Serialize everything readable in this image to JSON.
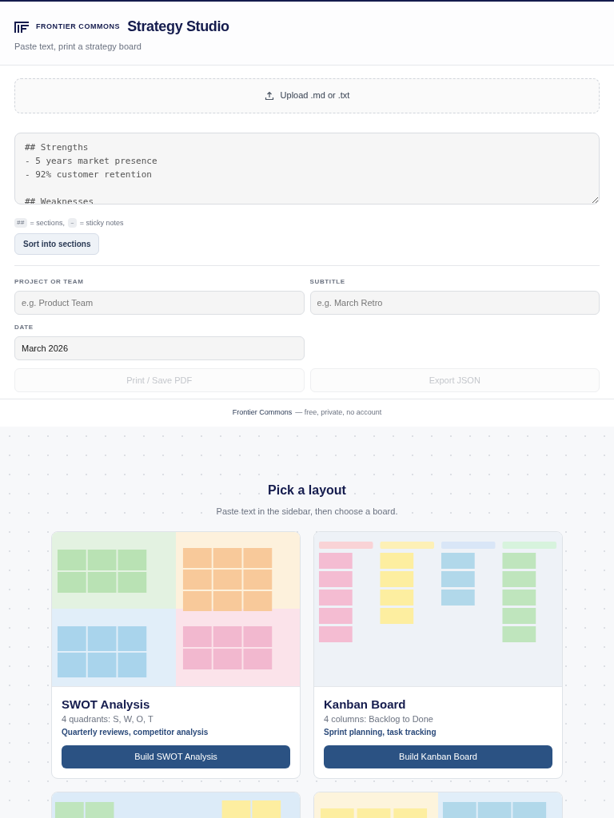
{
  "header": {
    "brand": "FRONTIER COMMONS",
    "title": "Strategy Studio",
    "tagline": "Paste text, print a strategy board"
  },
  "upload": {
    "label": "Upload .md or .txt"
  },
  "editor": {
    "value": "## Strengths\n- 5 years market presence\n- 92% customer retention\n\n## Weaknesses"
  },
  "hint": [
    {
      "kind": "code",
      "text": "##"
    },
    {
      "kind": "text",
      "text": "= sections,"
    },
    {
      "kind": "code",
      "text": "–"
    },
    {
      "kind": "text",
      "text": "= sticky notes"
    }
  ],
  "sort_button": "Sort into sections",
  "fields": [
    {
      "label": "PROJECT OR TEAM",
      "placeholder": "e.g. Product Team"
    },
    {
      "label": "SUBTITLE",
      "placeholder": "e.g. March Retro"
    },
    {
      "label": "DATE",
      "value": "March 2026"
    }
  ],
  "actions": [
    {
      "label": "Print / Save PDF",
      "disabled": true
    },
    {
      "label": "Export JSON",
      "disabled": true
    }
  ],
  "footer": {
    "link": "Frontier Commons",
    "text": "— free, private, no account"
  },
  "gallery": {
    "title": "Pick a layout",
    "subtitle": "Paste text in the sidebar, then choose a board."
  },
  "layouts": [
    {
      "kind": "swot",
      "title": "SWOT Analysis",
      "description": "4 quadrants: S, W, O, T",
      "use_cases": "Quarterly reviews, competitor analysis",
      "button": "Build SWOT Analysis"
    },
    {
      "kind": "kanban",
      "title": "Kanban Board",
      "description": "4 columns: Backlog to Done",
      "use_cases": "Sprint planning, task tracking",
      "button": "Build Kanban Board"
    },
    {
      "kind": "matrix"
    },
    {
      "kind": "split"
    }
  ]
}
